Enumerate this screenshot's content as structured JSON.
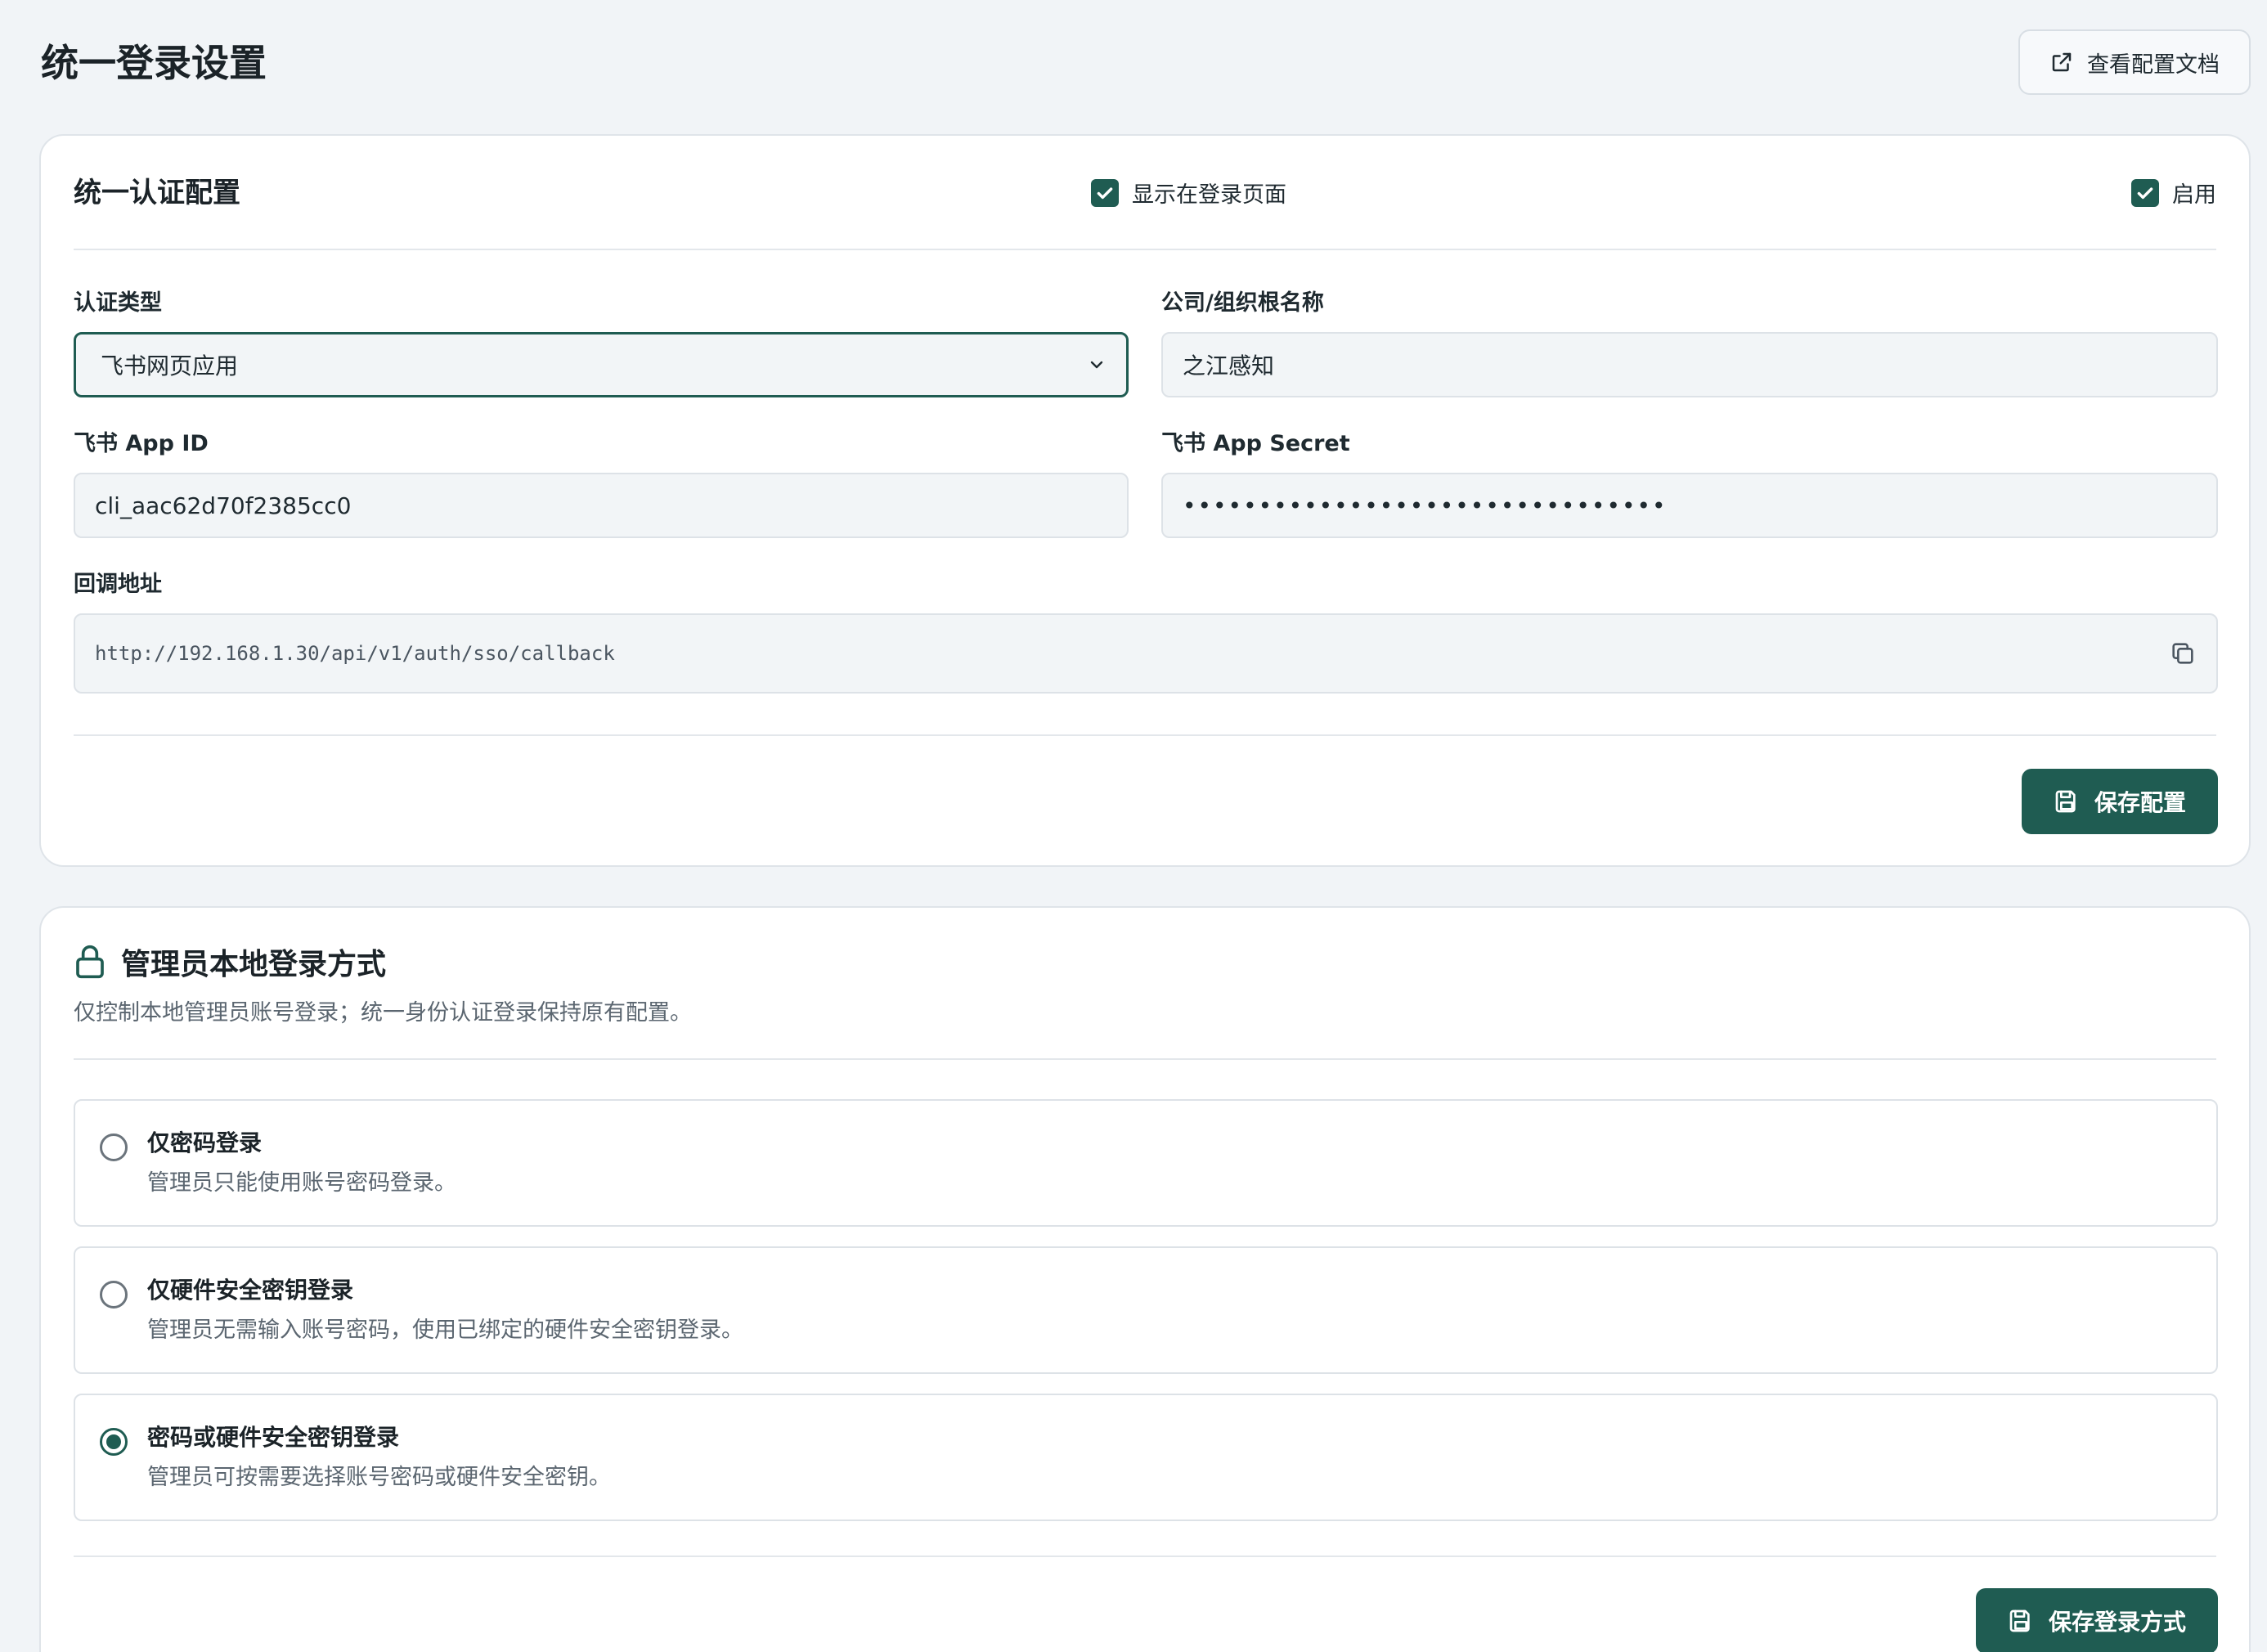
{
  "page": {
    "title": "统一登录设置",
    "doc_button_label": "查看配置文档"
  },
  "sso_card": {
    "title": "统一认证配置",
    "show_on_login_label": "显示在登录页面",
    "show_on_login_checked": true,
    "enable_label": "启用",
    "enable_checked": true,
    "auth_type_label": "认证类型",
    "auth_type_value": "飞书网页应用",
    "org_name_label": "公司/组织根名称",
    "org_name_value": "之江感知",
    "app_id_label": "飞书 App ID",
    "app_id_value": "cli_aac62d70f2385cc0",
    "app_secret_label": "飞书 App Secret",
    "app_secret_value": "••••••••••••••••••••••••••••••••",
    "callback_label": "回调地址",
    "callback_value": "http://192.168.1.30/api/v1/auth/sso/callback",
    "save_label": "保存配置"
  },
  "admin_card": {
    "title": "管理员本地登录方式",
    "description": "仅控制本地管理员账号登录；统一身份认证登录保持原有配置。",
    "options": [
      {
        "title": "仅密码登录",
        "description": "管理员只能使用账号密码登录。",
        "selected": false
      },
      {
        "title": "仅硬件安全密钥登录",
        "description": "管理员无需输入账号密码，使用已绑定的硬件安全密钥登录。",
        "selected": false
      },
      {
        "title": "密码或硬件安全密钥登录",
        "description": "管理员可按需要选择账号密码或硬件安全密钥。",
        "selected": true
      }
    ],
    "save_label": "保存登录方式"
  },
  "colors": {
    "primary": "#1f5c52",
    "background": "#f1f4f7",
    "card": "#ffffff",
    "border": "#dfe4e9"
  },
  "icons": {
    "doc_button": "external-link-icon",
    "copy": "copy-icon",
    "save": "save-icon",
    "lock": "lock-icon",
    "select": "chevron-down-icon",
    "checkbox": "check-icon"
  }
}
